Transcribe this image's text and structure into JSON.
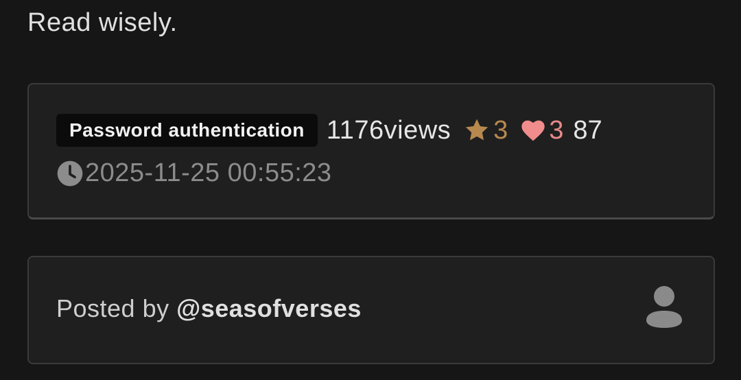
{
  "tagline": "Read wisely.",
  "post": {
    "tag": "Password authentication",
    "views": "1176views",
    "stars": "3",
    "hearts": "3",
    "extra_count": "87",
    "timestamp": "2025-11-25 00:55:23"
  },
  "author": {
    "prefix": "Posted by ",
    "handle": "@seasofverses"
  },
  "icons": {
    "star": "star-icon",
    "heart": "heart-icon",
    "clock": "clock-icon",
    "avatar": "user-icon"
  },
  "colors": {
    "background": "#161616",
    "card": "#1f1f1f",
    "star": "#b8894e",
    "heart": "#e88a8a",
    "muted": "#8c8c8c"
  }
}
